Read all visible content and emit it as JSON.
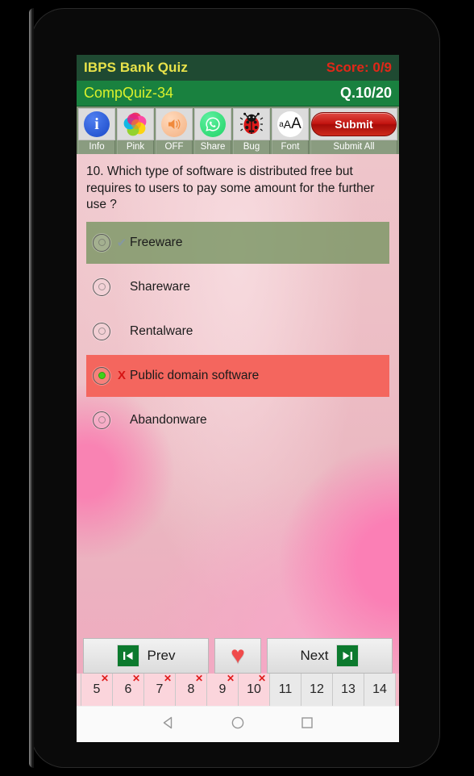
{
  "header": {
    "app_title": "IBPS Bank Quiz",
    "score": "Score: 0/9",
    "quiz_name": "CompQuiz-34",
    "question_index": "Q.10/20",
    "title_color": "#e8e24a",
    "score_color": "#e22718",
    "titlebar_bg": "#1f4a32",
    "quizbar_bg": "#19813f"
  },
  "toolbar": {
    "items": [
      {
        "label": "Info",
        "icon": "info-icon"
      },
      {
        "label": "Pink",
        "icon": "color-flower-icon"
      },
      {
        "label": "OFF",
        "icon": "speaker-icon"
      },
      {
        "label": "Share",
        "icon": "whatsapp-icon"
      },
      {
        "label": "Bug",
        "icon": "ladybug-icon"
      },
      {
        "label": "Font",
        "icon": "font-size-icon"
      },
      {
        "label": "Submit All",
        "icon": "submit-button-icon"
      }
    ],
    "submit_label": "Submit",
    "font_icon_text": {
      "small": "a",
      "medium": "A",
      "large": "A"
    },
    "info_glyph": "i"
  },
  "question": {
    "text": "10. Which type of software is distributed free but requires to users to pay some amount for the further use ?"
  },
  "options": [
    {
      "label": "Freeware",
      "state": "correct",
      "mark": "✔",
      "selected": false
    },
    {
      "label": "Shareware",
      "state": "normal",
      "mark": "",
      "selected": false
    },
    {
      "label": "Rentalware",
      "state": "normal",
      "mark": "",
      "selected": false
    },
    {
      "label": "Public domain software",
      "state": "wrong",
      "mark": "X",
      "selected": true
    },
    {
      "label": "Abandonware",
      "state": "normal",
      "mark": "",
      "selected": false
    }
  ],
  "nav": {
    "prev_label": "Prev",
    "next_label": "Next",
    "favorite_icon": "heart-icon",
    "prev_icon": "skip-previous-icon",
    "next_icon": "skip-next-icon",
    "prev_glyph": "◀|",
    "next_glyph": "|▶",
    "heart_glyph": "♥"
  },
  "number_strip": {
    "cells": [
      {
        "n": "",
        "answered": true,
        "wrong": true,
        "sliver": true
      },
      {
        "n": "5",
        "answered": true,
        "wrong": true,
        "sliver": false
      },
      {
        "n": "6",
        "answered": true,
        "wrong": true,
        "sliver": false
      },
      {
        "n": "7",
        "answered": true,
        "wrong": true,
        "sliver": false
      },
      {
        "n": "8",
        "answered": true,
        "wrong": true,
        "sliver": false
      },
      {
        "n": "9",
        "answered": true,
        "wrong": true,
        "sliver": false
      },
      {
        "n": "10",
        "answered": true,
        "wrong": true,
        "sliver": false
      },
      {
        "n": "11",
        "answered": false,
        "wrong": false,
        "sliver": false
      },
      {
        "n": "12",
        "answered": false,
        "wrong": false,
        "sliver": false
      },
      {
        "n": "13",
        "answered": false,
        "wrong": false,
        "sliver": false
      },
      {
        "n": "14",
        "answered": false,
        "wrong": false,
        "sliver": false
      }
    ],
    "wrong_mark": "✕"
  },
  "android_nav": {
    "back": "back-icon",
    "home": "home-icon",
    "recents": "recents-icon"
  },
  "colors": {
    "correct_row": "#7a9664",
    "wrong_row": "#f4665e",
    "selected_dot": "#3fd21a",
    "cross_red": "#d61414",
    "accent_green": "#19813f"
  }
}
